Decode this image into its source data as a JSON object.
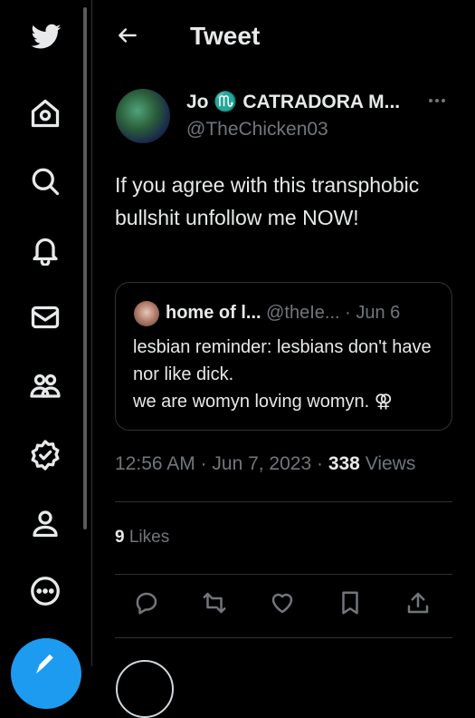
{
  "header": {
    "title": "Tweet"
  },
  "sidebar": {
    "items": [
      "twitter-logo",
      "home",
      "explore",
      "notifications",
      "messages",
      "communities",
      "verified",
      "profile",
      "more"
    ]
  },
  "tweet": {
    "display_name": "Jo ♏ CATRADORA M...",
    "handle": "@TheChicken03",
    "text": "If you agree with this transphobic bullshit unfollow me NOW!",
    "timestamp": "12:56 AM · Jun 7, 2023 · ",
    "views_count": "338",
    "views_label": " Views",
    "likes_count": "9",
    "likes_label": " Likes"
  },
  "quote": {
    "name": "home of l...",
    "handle": " @theIe...",
    "date": " · Jun 6",
    "text_line1": "lesbian reminder: lesbians don't have nor like dick.",
    "text_line2": "we are womyn loving womyn. ⚢"
  },
  "colors": {
    "background": "#000000",
    "text": "#e7e9ea",
    "muted": "#71767b",
    "accent": "#1d9bf0",
    "border": "#2f3336"
  }
}
